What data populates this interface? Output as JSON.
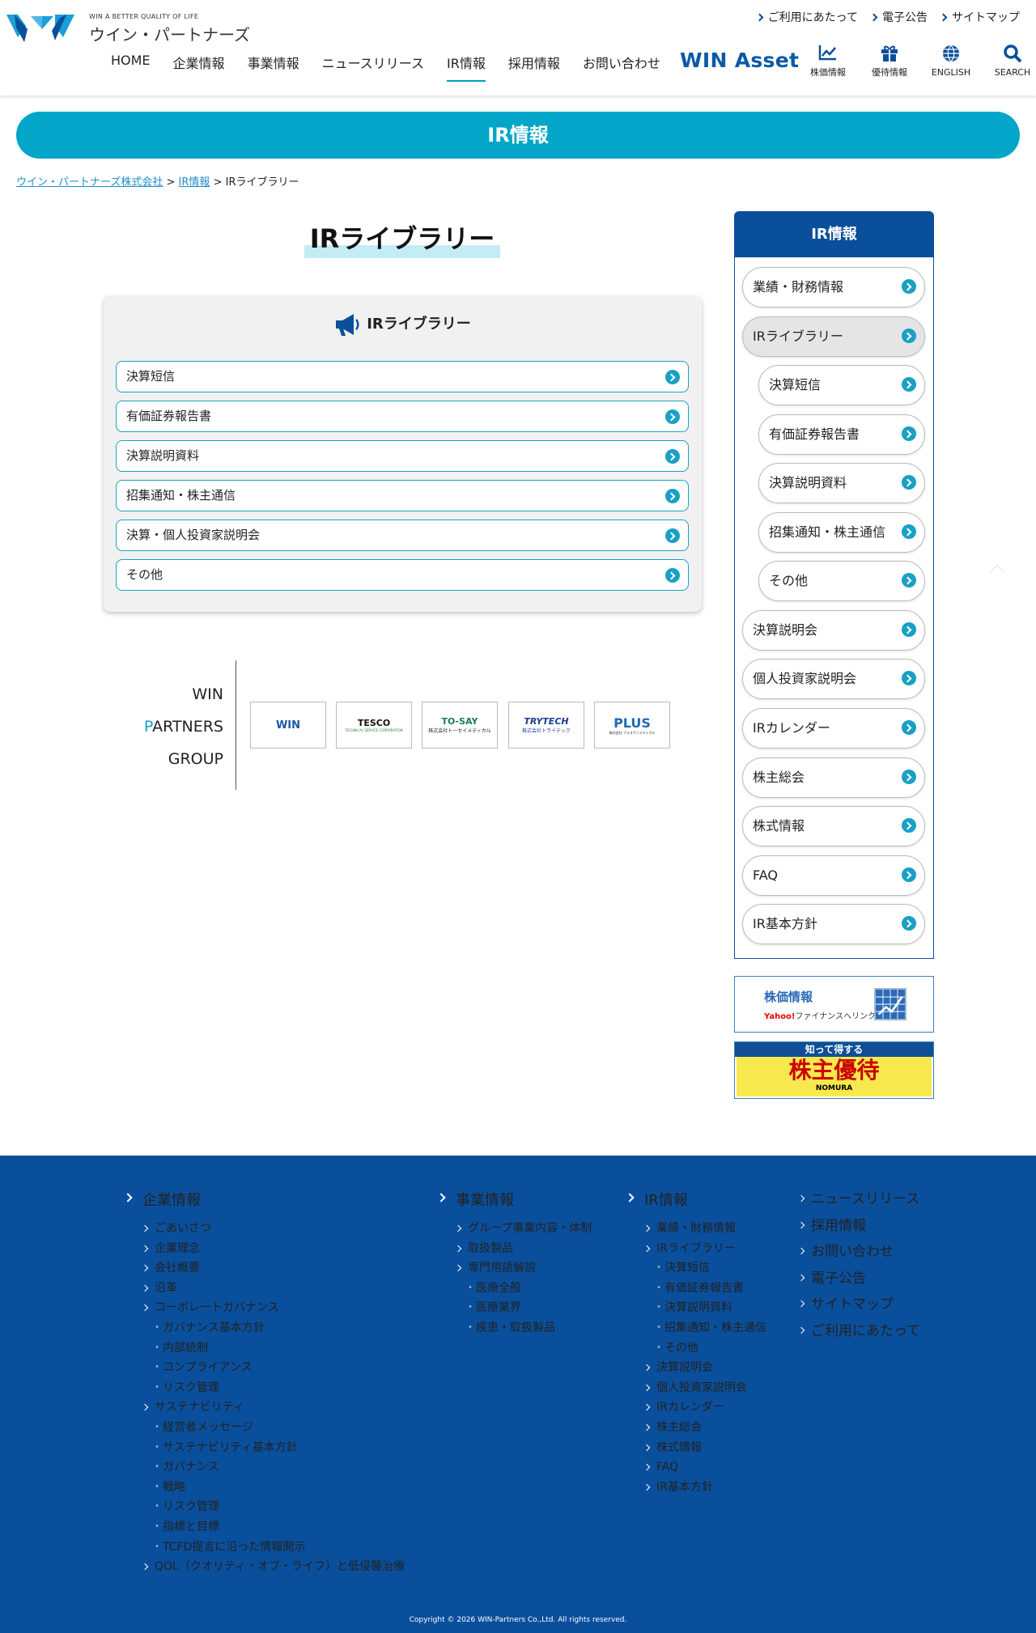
{
  "header": {
    "tagline": "WIN A BETTER QUALITY OF LIFE",
    "company": "ウイン・パートナーズ",
    "utility_links": [
      "ご利用にあたって",
      "電子公告",
      "サイトマップ"
    ],
    "nav": [
      "HOME",
      "企業情報",
      "事業情報",
      "ニュースリリース",
      "IR情報",
      "採用情報",
      "お問い合わせ"
    ],
    "win_asset": "WIN Asset",
    "icons": [
      {
        "icon": "chart-icon",
        "label": "株価情報"
      },
      {
        "icon": "gift-icon",
        "label": "優待情報"
      },
      {
        "icon": "globe-icon",
        "label": "ENGLISH"
      },
      {
        "icon": "search-icon",
        "label": "SEARCH"
      }
    ]
  },
  "banner": {
    "title": "IR情報"
  },
  "breadcrumb": {
    "home": "ウイン・パートナーズ株式会社",
    "sep": ">",
    "ir": "IR情報",
    "current": "IRライブラリー"
  },
  "main": {
    "title": "IRライブラリー",
    "library": {
      "heading": "IRライブラリー",
      "items": [
        "決算短信",
        "有価証券報告書",
        "決算説明資料",
        "招集通知・株主通信",
        "決算・個人投資家説明会",
        "その他"
      ]
    },
    "group": {
      "line1": "WIN",
      "line2_first": "P",
      "line2_rest": "ARTNERS",
      "line3": "GROUP",
      "logos": [
        {
          "name": "WIN",
          "sub": ""
        },
        {
          "name": "TESCO",
          "sub": "TECHNICAL SERVICE CORPORATION"
        },
        {
          "name": "TO-SAY",
          "sub": "株式会社トーセイメディカル"
        },
        {
          "name": "TRYTECH",
          "sub": "株式会社トライテック"
        },
        {
          "name": "PLUS",
          "sub": "株式会社 プラスワンメディカル"
        }
      ]
    }
  },
  "sidebar": {
    "title": "IR情報",
    "items": [
      "業績・財務情報",
      "IRライブラリー",
      "決算短信",
      "有価証券報告書",
      "決算説明資料",
      "招集通知・株主通信",
      "その他",
      "決算説明会",
      "個人投資家説明会",
      "IRカレンダー",
      "株主総会",
      "株式情報",
      "FAQ",
      "IR基本方針"
    ],
    "stock_banner": {
      "title": "株価情報",
      "yahoo": "Yahoo!",
      "rest": "ファイナンスへリンク"
    },
    "yuutai_banner": {
      "top": "知って得する",
      "main": "株主優待",
      "brand": "NOMURA"
    }
  },
  "footer": {
    "col1": {
      "heading": "企業情報",
      "items": [
        {
          "l": 1,
          "t": "ごあいさつ"
        },
        {
          "l": 1,
          "t": "企業理念"
        },
        {
          "l": 1,
          "t": "会社概要"
        },
        {
          "l": 1,
          "t": "沿革"
        },
        {
          "l": 1,
          "t": "コーポレートガバナンス"
        },
        {
          "l": 2,
          "t": "ガバナンス基本方針"
        },
        {
          "l": 2,
          "t": "内部統制"
        },
        {
          "l": 2,
          "t": "コンプライアンス"
        },
        {
          "l": 2,
          "t": "リスク管理"
        },
        {
          "l": 1,
          "t": "サステナビリティ"
        },
        {
          "l": 2,
          "t": "経営者メッセージ"
        },
        {
          "l": 2,
          "t": "サステナビリティ基本方針"
        },
        {
          "l": 2,
          "t": "ガバナンス"
        },
        {
          "l": 2,
          "t": "戦略"
        },
        {
          "l": 2,
          "t": "リスク管理"
        },
        {
          "l": 2,
          "t": "指標と目標"
        },
        {
          "l": 2,
          "t": "TCFD提言に沿った情報開示"
        },
        {
          "l": 1,
          "t": "QOL（クオリティ・オブ・ライフ）と低侵襲治療"
        }
      ]
    },
    "col2": {
      "heading": "事業情報",
      "items": [
        {
          "l": 1,
          "t": "グループ事業内容・体制"
        },
        {
          "l": 1,
          "t": "取扱製品"
        },
        {
          "l": 1,
          "t": "専門用語解説"
        },
        {
          "l": 2,
          "t": "医療全般"
        },
        {
          "l": 2,
          "t": "医療業界"
        },
        {
          "l": 2,
          "t": "疾患・取扱製品"
        }
      ]
    },
    "col3": {
      "heading": "IR情報",
      "items": [
        {
          "l": 1,
          "t": "業績・財務情報"
        },
        {
          "l": 1,
          "t": "IRライブラリー"
        },
        {
          "l": 2,
          "t": "決算短信"
        },
        {
          "l": 2,
          "t": "有価証券報告書"
        },
        {
          "l": 2,
          "t": "決算説明資料"
        },
        {
          "l": 2,
          "t": "招集通知・株主通信"
        },
        {
          "l": 2,
          "t": "その他"
        },
        {
          "l": 1,
          "t": "決算説明会"
        },
        {
          "l": 1,
          "t": "個人投資家説明会"
        },
        {
          "l": 1,
          "t": "IRカレンダー"
        },
        {
          "l": 1,
          "t": "株主総会"
        },
        {
          "l": 1,
          "t": "株式情報"
        },
        {
          "l": 1,
          "t": "FAQ"
        },
        {
          "l": 1,
          "t": "IR基本方針"
        }
      ]
    },
    "col4": [
      "ニュースリリース",
      "採用情報",
      "お問い合わせ",
      "電子公告",
      "サイトマップ",
      "ご利用にあたって"
    ],
    "copyright": "Copyright © 2026 WIN-Partners Co.,Ltd. All rights reserved."
  }
}
